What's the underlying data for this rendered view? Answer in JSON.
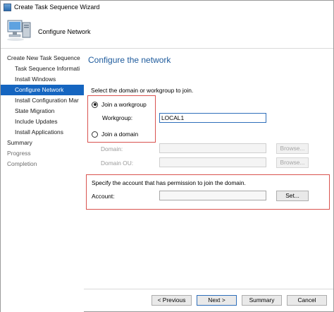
{
  "window": {
    "title": "Create Task Sequence Wizard"
  },
  "header": {
    "title": "Configure Network"
  },
  "sidebar": {
    "items": [
      {
        "label": "Create New Task Sequence",
        "level": 0
      },
      {
        "label": "Task Sequence Informati",
        "level": 1
      },
      {
        "label": "Install Windows",
        "level": 1
      },
      {
        "label": "Configure Network",
        "level": 1,
        "active": true
      },
      {
        "label": "Install Configuration Mar",
        "level": 1
      },
      {
        "label": "State Migration",
        "level": 1
      },
      {
        "label": "Include Updates",
        "level": 1
      },
      {
        "label": "Install Applications",
        "level": 1
      },
      {
        "label": "Summary",
        "level": 0
      },
      {
        "label": "Progress",
        "level": 0,
        "dim": true
      },
      {
        "label": "Completion",
        "level": 0,
        "dim": true
      }
    ]
  },
  "main": {
    "title": "Configure the network",
    "instruction": "Select the domain or workgroup to join.",
    "join_workgroup": {
      "label": "Join a workgroup",
      "selected": true
    },
    "workgroup": {
      "label": "Workgroup:",
      "value": "LOCAL1"
    },
    "join_domain": {
      "label": "Join a domain",
      "selected": false
    },
    "domain": {
      "label": "Domain:",
      "value": "",
      "browse_label": "Browse..."
    },
    "domain_ou": {
      "label": "Domain OU:",
      "value": "",
      "browse_label": "Browse..."
    },
    "account_section": {
      "description": "Specify the account that has permission to join the domain.",
      "account_label": "Account:",
      "account_value": "",
      "set_label": "Set..."
    }
  },
  "footer": {
    "previous_label": "< Previous",
    "next_label": "Next >",
    "summary_label": "Summary",
    "cancel_label": "Cancel"
  },
  "colors": {
    "accent": "#1565c0",
    "title_blue": "#1d5a9c",
    "highlight_red": "#d9534f"
  }
}
